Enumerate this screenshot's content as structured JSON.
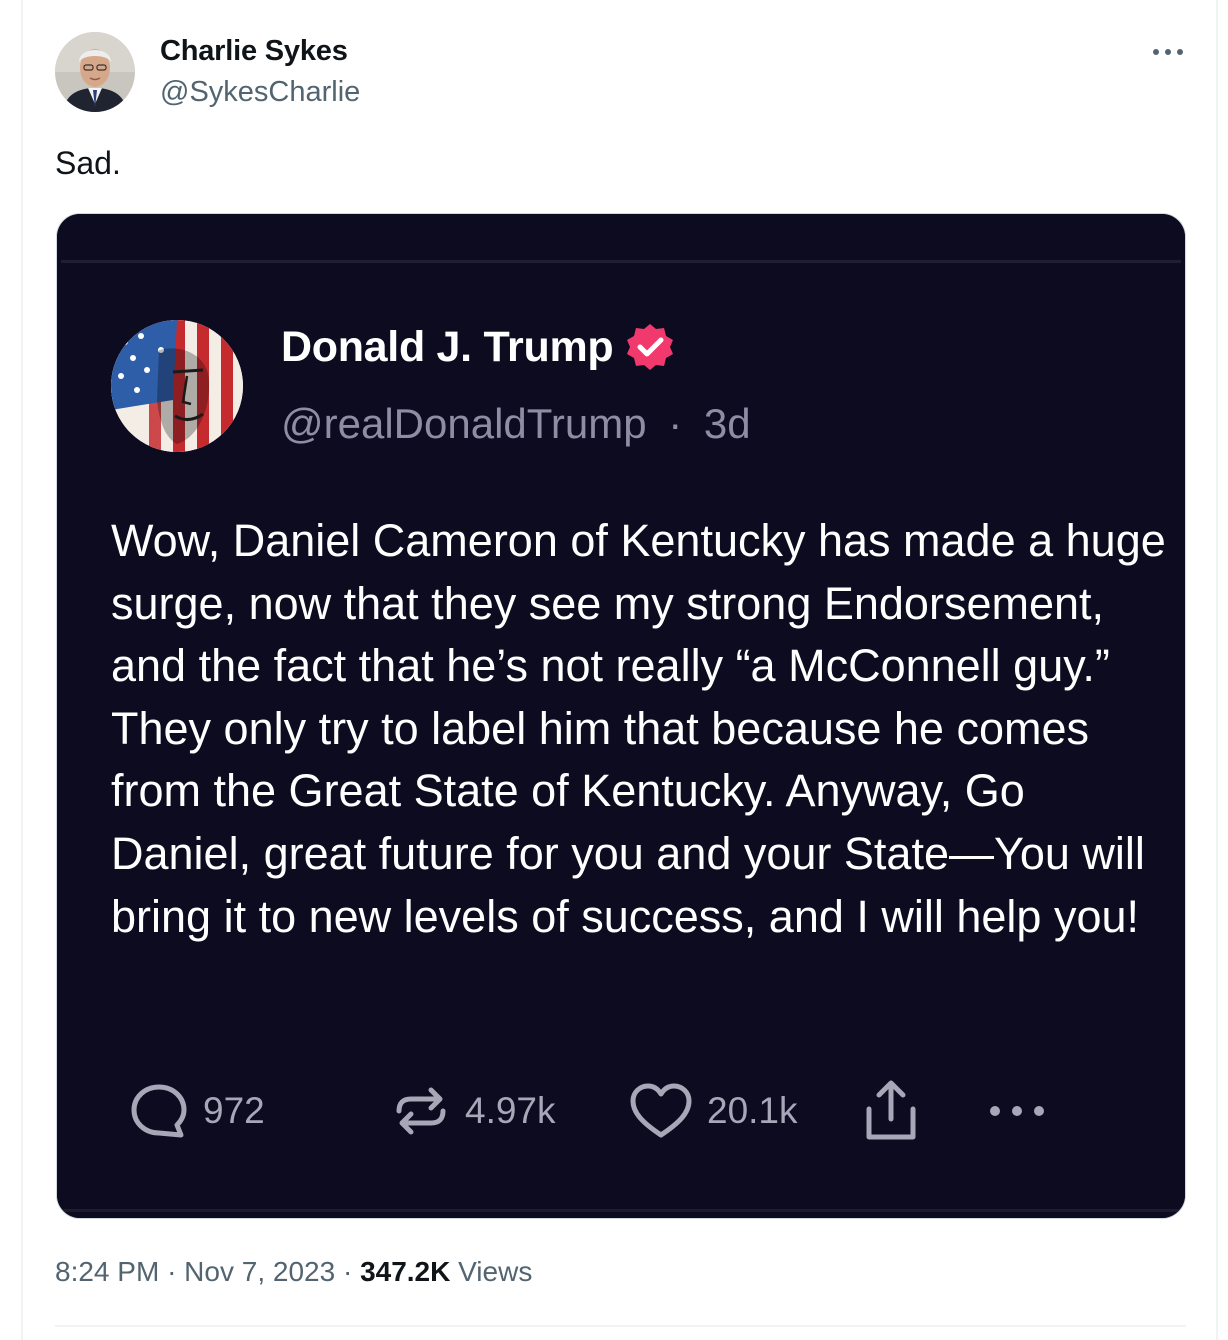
{
  "tweet": {
    "author_name": "Charlie Sykes",
    "author_handle": "@SykesCharlie",
    "text": "Sad.",
    "time": "8:24 PM",
    "date": "Nov 7, 2023",
    "separator": "·",
    "views_count": "347.2K",
    "views_label": "Views",
    "more_icon": "more-horizontal-icon"
  },
  "embedded_post": {
    "author_name": "Donald J. Trump",
    "author_handle": "@realDonaldTrump",
    "separator": "·",
    "age": "3d",
    "verified_color": "#f2396d",
    "body": "Wow, Daniel Cameron of Kentucky has made a huge surge, now that they see my strong Endorsement, and the fact that he’s not really “a McConnell guy.” They only try to label him that because he comes from the Great State of Kentucky. Anyway, Go Daniel, great future for you and your State—You will bring it to new levels of success, and I will help you!",
    "actions": {
      "replies": "972",
      "retruths": "4.97k",
      "likes": "20.1k"
    },
    "background_color": "#0c0b1f"
  }
}
